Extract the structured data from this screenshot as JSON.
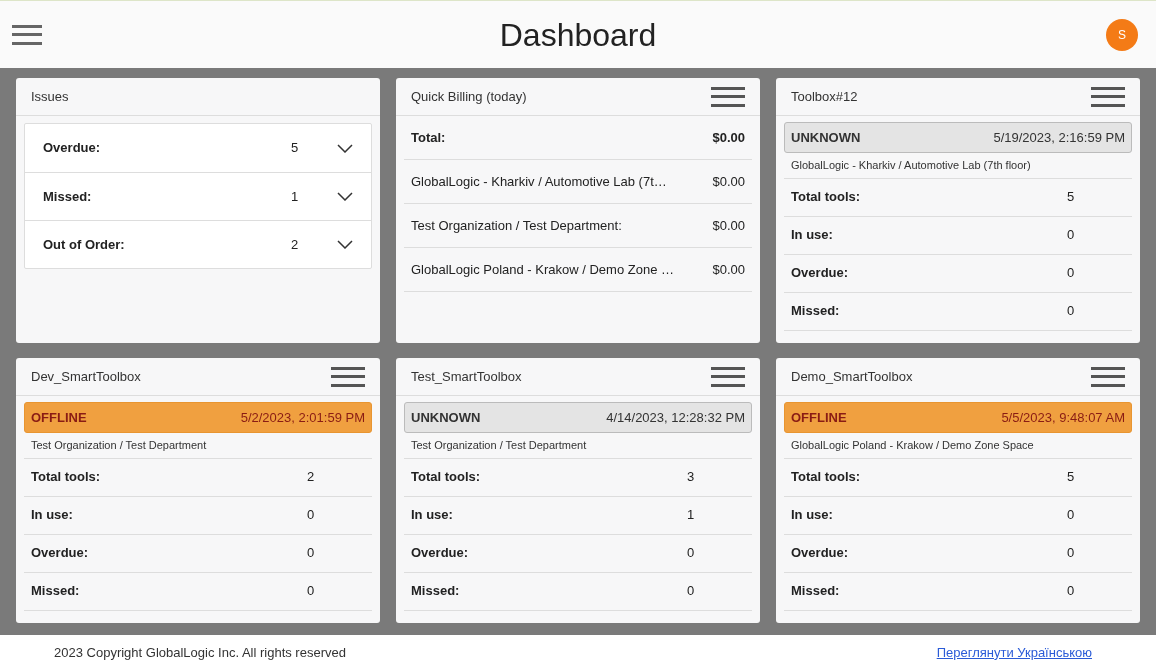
{
  "header": {
    "title": "Dashboard",
    "avatar": "S"
  },
  "issues": {
    "title": "Issues",
    "rows": [
      {
        "label": "Overdue:",
        "count": "5"
      },
      {
        "label": "Missed:",
        "count": "1"
      },
      {
        "label": "Out of Order:",
        "count": "2"
      }
    ]
  },
  "billing": {
    "title": "Quick Billing (today)",
    "rows": [
      {
        "kind": "total",
        "label": "Total:",
        "amount": "$0.00"
      },
      {
        "kind": "item",
        "label": "GlobalLogic - Kharkiv / Automotive Lab (7t…",
        "amount": "$0.00"
      },
      {
        "kind": "item",
        "label": "Test Organization / Test Department:",
        "amount": "$0.00"
      },
      {
        "kind": "item",
        "label": "GlobalLogic Poland - Krakow / Demo Zone …",
        "amount": "$0.00"
      }
    ]
  },
  "toolboxes": [
    {
      "title": "Toolbox#12",
      "status": {
        "kind": "unknown",
        "label": "UNKNOWN",
        "timestamp": "5/19/2023, 2:16:59 PM"
      },
      "location": "GlobalLogic - Kharkiv / Automotive Lab (7th floor)",
      "stats": [
        {
          "label": "Total tools:",
          "value": "5"
        },
        {
          "label": "In use:",
          "value": "0"
        },
        {
          "label": "Overdue:",
          "value": "0"
        },
        {
          "label": "Missed:",
          "value": "0"
        }
      ]
    },
    {
      "title": "Dev_SmartToolbox",
      "status": {
        "kind": "offline",
        "label": "OFFLINE",
        "timestamp": "5/2/2023, 2:01:59 PM"
      },
      "location": "Test Organization / Test Department",
      "stats": [
        {
          "label": "Total tools:",
          "value": "2"
        },
        {
          "label": "In use:",
          "value": "0"
        },
        {
          "label": "Overdue:",
          "value": "0"
        },
        {
          "label": "Missed:",
          "value": "0"
        }
      ]
    },
    {
      "title": "Test_SmartToolbox",
      "status": {
        "kind": "unknown",
        "label": "UNKNOWN",
        "timestamp": "4/14/2023, 12:28:32 PM"
      },
      "location": "Test Organization / Test Department",
      "stats": [
        {
          "label": "Total tools:",
          "value": "3"
        },
        {
          "label": "In use:",
          "value": "1"
        },
        {
          "label": "Overdue:",
          "value": "0"
        },
        {
          "label": "Missed:",
          "value": "0"
        }
      ]
    },
    {
      "title": "Demo_SmartToolbox",
      "status": {
        "kind": "offline",
        "label": "OFFLINE",
        "timestamp": "5/5/2023, 9:48:07 AM"
      },
      "location": "GlobalLogic Poland - Krakow / Demo Zone Space",
      "stats": [
        {
          "label": "Total tools:",
          "value": "5"
        },
        {
          "label": "In use:",
          "value": "0"
        },
        {
          "label": "Overdue:",
          "value": "0"
        },
        {
          "label": "Missed:",
          "value": "0"
        }
      ]
    }
  ],
  "footer": {
    "copyright": "2023 Copyright GlobalLogic Inc. All rights reserved",
    "language_link": "Переглянути Українською"
  }
}
